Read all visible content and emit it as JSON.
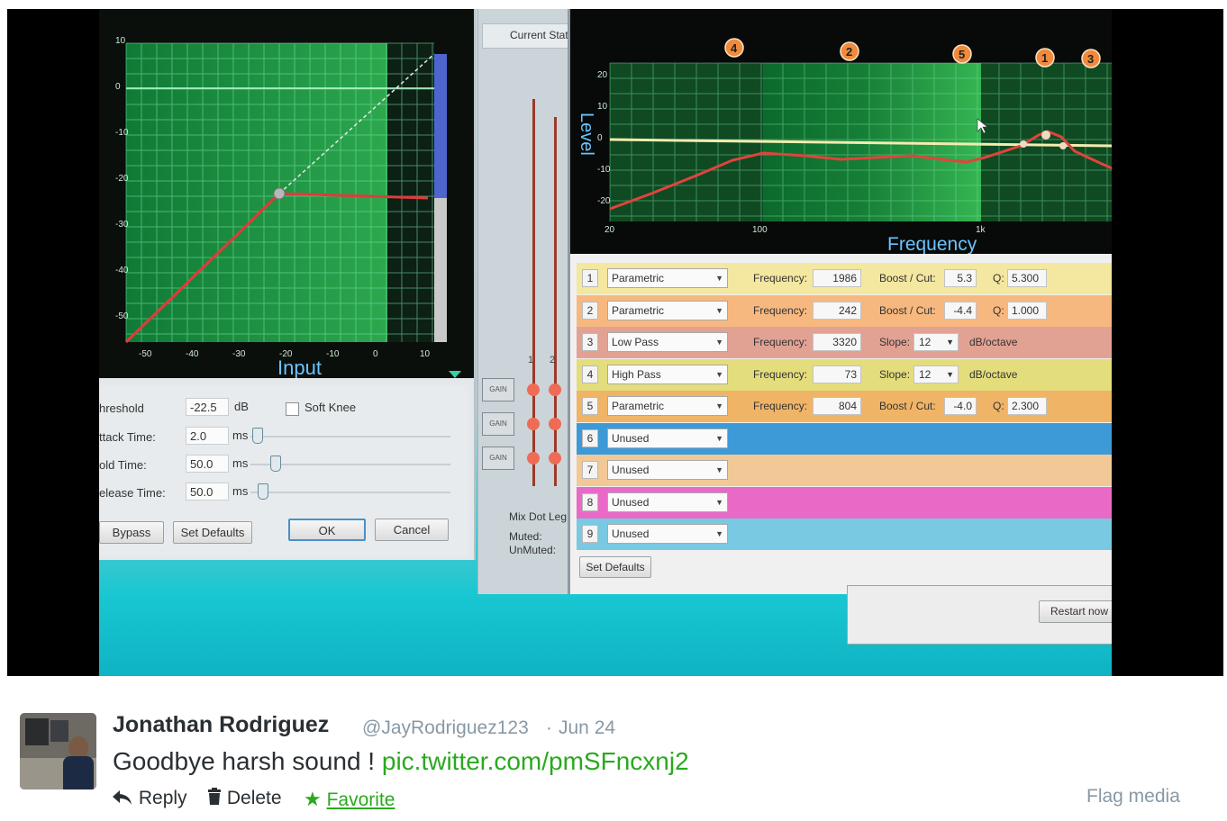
{
  "compressor": {
    "y_ticks": [
      "10",
      "0",
      "-10",
      "-20",
      "-30",
      "-40",
      "-50"
    ],
    "x_ticks": [
      "-50",
      "-40",
      "-30",
      "-20",
      "-10",
      "0",
      "10"
    ],
    "x_axis_label": "Input",
    "threshold_label": "hreshold",
    "threshold_value": "-22.5",
    "threshold_unit": "dB",
    "soft_knee_label": "Soft Knee",
    "attack_label": "ttack Time:",
    "attack_value": "2.0",
    "hold_label": "old Time:",
    "hold_value": "50.0",
    "release_label": "elease Time:",
    "release_value": "50.0",
    "time_unit": "ms",
    "bypass_label": "Bypass",
    "set_defaults_label": "Set Defaults",
    "ok_label": "OK",
    "cancel_label": "Cancel"
  },
  "middle": {
    "current_state": "Current State",
    "channels": [
      "1",
      "2"
    ],
    "gain_label": "GAIN",
    "legend_title": "Mix Dot Leg",
    "muted_label": "Muted:",
    "unmuted_label": "UnMuted:"
  },
  "eq": {
    "level_label": "Level",
    "frequency_label": "Frequency",
    "y_ticks": [
      "20",
      "10",
      "0",
      "-10",
      "-20"
    ],
    "x_ticks": [
      "20",
      "100",
      "1k"
    ],
    "band_markers": [
      "4",
      "2",
      "5",
      "1",
      "3"
    ],
    "labels": {
      "frequency": "Frequency:",
      "boost": "Boost / Cut:",
      "q": "Q:",
      "slope": "Slope:",
      "db_octave": "dB/octave"
    },
    "bands": [
      {
        "n": "1",
        "type": "Parametric",
        "freq": "1986",
        "boost": "5.3",
        "q": "5.300",
        "color": "#f4e7a0"
      },
      {
        "n": "2",
        "type": "Parametric",
        "freq": "242",
        "boost": "-4.4",
        "q": "1.000",
        "color": "#f7b87f"
      },
      {
        "n": "3",
        "type": "Low Pass",
        "freq": "3320",
        "slope": "12",
        "color": "#e2a293"
      },
      {
        "n": "4",
        "type": "High Pass",
        "freq": "73",
        "slope": "12",
        "color": "#e3dd7c"
      },
      {
        "n": "5",
        "type": "Parametric",
        "freq": "804",
        "boost": "-4.0",
        "q": "2.300",
        "color": "#f0b467"
      },
      {
        "n": "6",
        "type": "Unused",
        "color": "#3e9ad6"
      },
      {
        "n": "7",
        "type": "Unused",
        "color": "#f2c896"
      },
      {
        "n": "8",
        "type": "Unused",
        "color": "#e86ac6"
      },
      {
        "n": "9",
        "type": "Unused",
        "color": "#79c9e2"
      }
    ],
    "set_defaults_label": "Set Defaults",
    "restart_label": "Restart now"
  },
  "tweet": {
    "name": "Jonathan Rodriguez",
    "handle": "@JayRodriguez123",
    "separator": "·",
    "date": "Jun 24",
    "text": "Goodbye harsh sound !",
    "link": "pic.twitter.com/pmSFncxnj2",
    "reply_label": "Reply",
    "delete_label": "Delete",
    "favorite_label": "Favorite",
    "flag_label": "Flag media",
    "link_color": "#2aa91e"
  }
}
